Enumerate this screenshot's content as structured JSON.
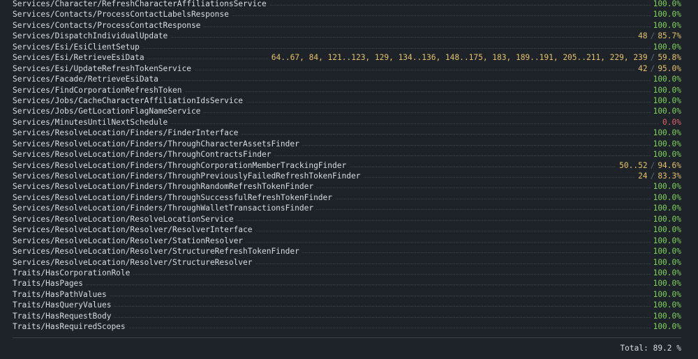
{
  "rows": [
    {
      "name": "Services/Character/RefreshCharacterAffiliationsService",
      "uncovered": "",
      "percent": "100.0%",
      "status": "full"
    },
    {
      "name": "Services/Contacts/ProcessContactLabelsResponse",
      "uncovered": "",
      "percent": "100.0%",
      "status": "full"
    },
    {
      "name": "Services/Contacts/ProcessContactResponse",
      "uncovered": "",
      "percent": "100.0%",
      "status": "full"
    },
    {
      "name": "Services/DispatchIndividualUpdate",
      "uncovered": "48",
      "percent": "85.7%",
      "status": "mid"
    },
    {
      "name": "Services/Esi/EsiClientSetup",
      "uncovered": "",
      "percent": "100.0%",
      "status": "full"
    },
    {
      "name": "Services/Esi/RetrieveEsiData",
      "uncovered": "64..67, 84, 121..123, 129, 134..136, 148..175, 183, 189..191, 205..211, 229, 239",
      "percent": "59.8%",
      "status": "mid"
    },
    {
      "name": "Services/Esi/UpdateRefreshTokenService",
      "uncovered": "42",
      "percent": "95.0%",
      "status": "mid"
    },
    {
      "name": "Services/Facade/RetrieveEsiData",
      "uncovered": "",
      "percent": "100.0%",
      "status": "full"
    },
    {
      "name": "Services/FindCorporationRefreshToken",
      "uncovered": "",
      "percent": "100.0%",
      "status": "full"
    },
    {
      "name": "Services/Jobs/CacheCharacterAffiliationIdsService",
      "uncovered": "",
      "percent": "100.0%",
      "status": "full"
    },
    {
      "name": "Services/Jobs/GetLocationFlagNameService",
      "uncovered": "",
      "percent": "100.0%",
      "status": "full"
    },
    {
      "name": "Services/MinutesUntilNextSchedule",
      "uncovered": "",
      "percent": "0.0%",
      "status": "zero"
    },
    {
      "name": "Services/ResolveLocation/Finders/FinderInterface",
      "uncovered": "",
      "percent": "100.0%",
      "status": "full"
    },
    {
      "name": "Services/ResolveLocation/Finders/ThroughCharacterAssetsFinder",
      "uncovered": "",
      "percent": "100.0%",
      "status": "full"
    },
    {
      "name": "Services/ResolveLocation/Finders/ThroughContractsFinder",
      "uncovered": "",
      "percent": "100.0%",
      "status": "full"
    },
    {
      "name": "Services/ResolveLocation/Finders/ThroughCorporationMemberTrackingFinder",
      "uncovered": "50..52",
      "percent": "94.6%",
      "status": "mid"
    },
    {
      "name": "Services/ResolveLocation/Finders/ThroughPreviouslyFailedRefreshTokenFinder",
      "uncovered": "24",
      "percent": "83.3%",
      "status": "mid"
    },
    {
      "name": "Services/ResolveLocation/Finders/ThroughRandomRefreshTokenFinder",
      "uncovered": "",
      "percent": "100.0%",
      "status": "full"
    },
    {
      "name": "Services/ResolveLocation/Finders/ThroughSuccessfulRefreshTokenFinder",
      "uncovered": "",
      "percent": "100.0%",
      "status": "full"
    },
    {
      "name": "Services/ResolveLocation/Finders/ThroughWalletTransactionsFinder",
      "uncovered": "",
      "percent": "100.0%",
      "status": "full"
    },
    {
      "name": "Services/ResolveLocation/ResolveLocationService",
      "uncovered": "",
      "percent": "100.0%",
      "status": "full"
    },
    {
      "name": "Services/ResolveLocation/Resolver/ResolverInterface",
      "uncovered": "",
      "percent": "100.0%",
      "status": "full"
    },
    {
      "name": "Services/ResolveLocation/Resolver/StationResolver",
      "uncovered": "",
      "percent": "100.0%",
      "status": "full"
    },
    {
      "name": "Services/ResolveLocation/Resolver/StructureRefreshTokenFinder",
      "uncovered": "",
      "percent": "100.0%",
      "status": "full"
    },
    {
      "name": "Services/ResolveLocation/Resolver/StructureResolver",
      "uncovered": "",
      "percent": "100.0%",
      "status": "full"
    },
    {
      "name": "Traits/HasCorporationRole",
      "uncovered": "",
      "percent": "100.0%",
      "status": "full"
    },
    {
      "name": "Traits/HasPages",
      "uncovered": "",
      "percent": "100.0%",
      "status": "full"
    },
    {
      "name": "Traits/HasPathValues",
      "uncovered": "",
      "percent": "100.0%",
      "status": "full"
    },
    {
      "name": "Traits/HasQueryValues",
      "uncovered": "",
      "percent": "100.0%",
      "status": "full"
    },
    {
      "name": "Traits/HasRequestBody",
      "uncovered": "",
      "percent": "100.0%",
      "status": "full"
    },
    {
      "name": "Traits/HasRequiredScopes",
      "uncovered": "",
      "percent": "100.0%",
      "status": "full"
    }
  ],
  "separator": "/",
  "total": {
    "label": "Total: 89.2 %"
  },
  "colors": {
    "background": "#1e232a",
    "text": "#d8dde4",
    "full": "#7ed35a",
    "mid": "#e5c16a",
    "zero": "#e0616a"
  }
}
